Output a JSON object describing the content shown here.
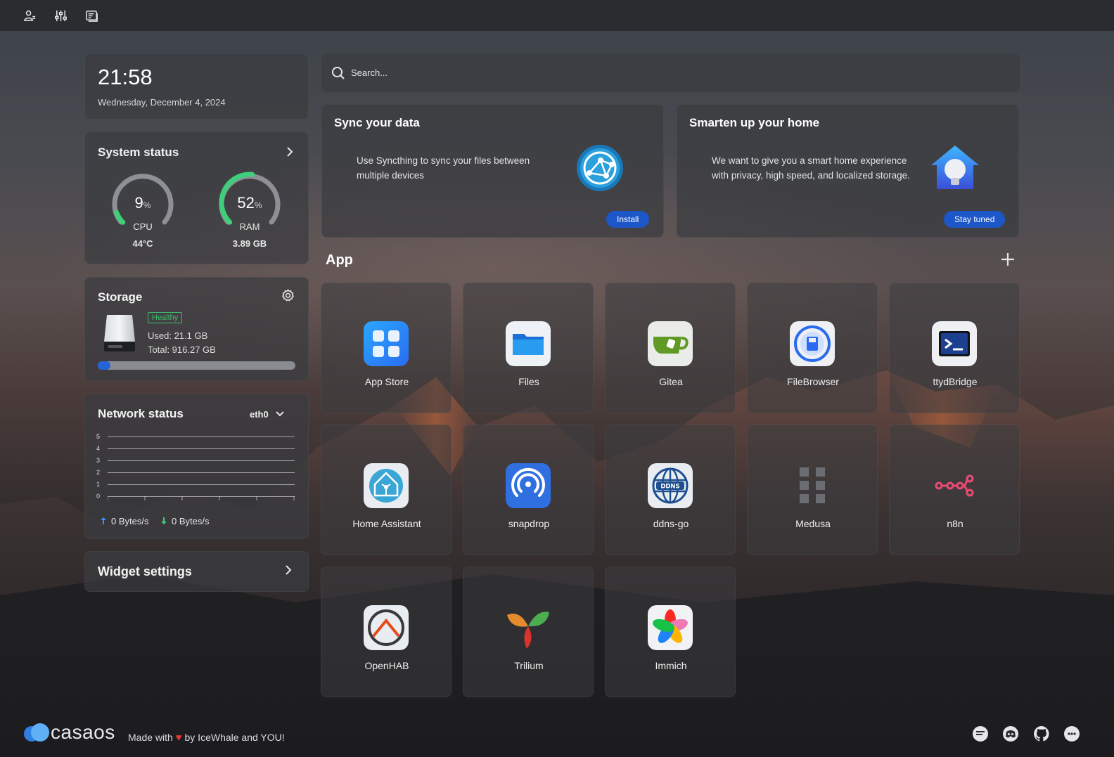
{
  "clock": {
    "time": "21:58",
    "date": "Wednesday, December 4, 2024"
  },
  "system_status": {
    "title": "System status",
    "cpu": {
      "value": "9",
      "unit": "%",
      "label": "CPU",
      "sub": "44°C",
      "percent": 9
    },
    "ram": {
      "value": "52",
      "unit": "%",
      "label": "RAM",
      "sub": "3.89 GB",
      "percent": 52
    }
  },
  "storage": {
    "title": "Storage",
    "health": "Healthy",
    "used": "Used: 21.1 GB",
    "total": "Total: 916.27 GB",
    "used_fraction": 0.023
  },
  "network": {
    "title": "Network status",
    "interface": "eth0",
    "y_ticks": [
      "5",
      "4",
      "3",
      "2",
      "1",
      "0"
    ],
    "upload": "0 Bytes/s",
    "download": "0 Bytes/s"
  },
  "widget_settings": {
    "title": "Widget settings"
  },
  "search": {
    "placeholder": "Search..."
  },
  "promos": [
    {
      "title": "Sync your data",
      "desc": "Use Syncthing to sync your files between multiple devices",
      "button": "Install"
    },
    {
      "title": "Smarten up your home",
      "desc": "We want to give you a smart home experience with privacy, high speed, and localized storage.",
      "button": "Stay tuned"
    }
  ],
  "apps_section": {
    "title": "App"
  },
  "apps": [
    {
      "name": "App Store",
      "icon": "app-store-icon"
    },
    {
      "name": "Files",
      "icon": "folder-icon"
    },
    {
      "name": "Gitea",
      "icon": "gitea-icon"
    },
    {
      "name": "FileBrowser",
      "icon": "filebrowser-icon"
    },
    {
      "name": "ttydBridge",
      "icon": "terminal-icon"
    },
    {
      "name": "Home Assistant",
      "icon": "home-assistant-icon"
    },
    {
      "name": "snapdrop",
      "icon": "snapdrop-icon"
    },
    {
      "name": "ddns-go",
      "icon": "ddns-icon"
    },
    {
      "name": "Medusa",
      "icon": "medusa-icon"
    },
    {
      "name": "n8n",
      "icon": "n8n-icon"
    },
    {
      "name": "OpenHAB",
      "icon": "openhab-icon"
    },
    {
      "name": "Trilium",
      "icon": "trilium-icon"
    },
    {
      "name": "Immich",
      "icon": "immich-icon"
    }
  ],
  "footer": {
    "brand": "casaos",
    "made_with": "Made with",
    "by": "by IceWhale and YOU!"
  },
  "colors": {
    "accent": "#1d56c9",
    "healthy": "#3fbf6e",
    "gauge_green": "#3fcf7a",
    "gauge_track": "#8e9096"
  }
}
